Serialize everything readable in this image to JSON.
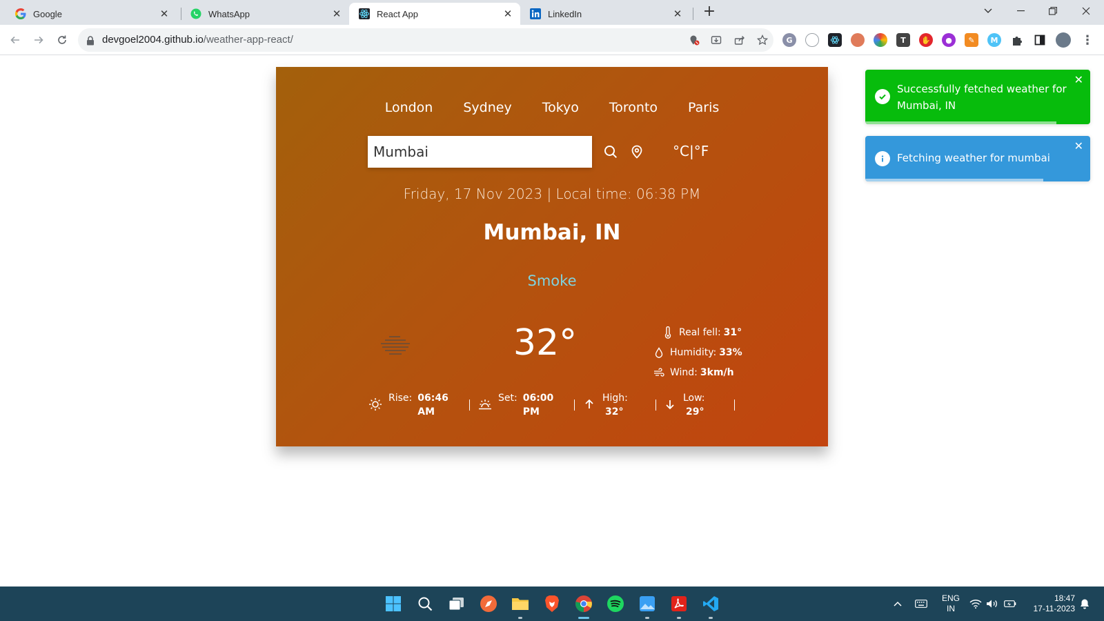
{
  "browser": {
    "tabs": [
      {
        "label": "Google",
        "icon": "google-icon"
      },
      {
        "label": "WhatsApp",
        "icon": "whatsapp-icon"
      },
      {
        "label": "React App",
        "icon": "react-icon",
        "active": true
      },
      {
        "label": "LinkedIn",
        "icon": "linkedin-icon"
      }
    ],
    "url_host": "devgoel2004.github.io",
    "url_path": "/weather-app-react/"
  },
  "weather": {
    "cities": [
      "London",
      "Sydney",
      "Tokyo",
      "Toronto",
      "Paris"
    ],
    "search_value": "Mumbai",
    "units_celsius": "°C",
    "units_separator": "|",
    "units_fahrenheit": "°F",
    "datetime": "Friday, 17 Nov 2023 | Local time: 06:38 PM",
    "location": "Mumbai, IN",
    "condition": "Smoke",
    "condition_icon": "haze-icon",
    "temperature": "32°",
    "details": {
      "real_feel_label": "Real fell:",
      "real_feel_value": "31°",
      "humidity_label": "Humidity:",
      "humidity_value": "33%",
      "wind_label": "Wind:",
      "wind_value": "3km/h"
    },
    "bottom": {
      "rise_label": "Rise:",
      "rise_value": "06:46 AM",
      "set_label": "Set:",
      "set_value": "06:00 PM",
      "high_label": "High:",
      "high_value": "32°",
      "low_label": "Low:",
      "low_value": "29°"
    },
    "colors": {
      "gradient_start": "#a3600c",
      "gradient_end": "#c2440f",
      "condition_text": "#7fd3e0"
    }
  },
  "toasts": [
    {
      "type": "success",
      "text": "Successfully fetched weather for Mumbai, IN",
      "color": "#07bc0c"
    },
    {
      "type": "info",
      "text": "Fetching weather for mumbai",
      "color": "#3498db"
    }
  ],
  "taskbar": {
    "language": "ENG",
    "region": "IN",
    "time": "18:47",
    "date": "17-11-2023"
  }
}
